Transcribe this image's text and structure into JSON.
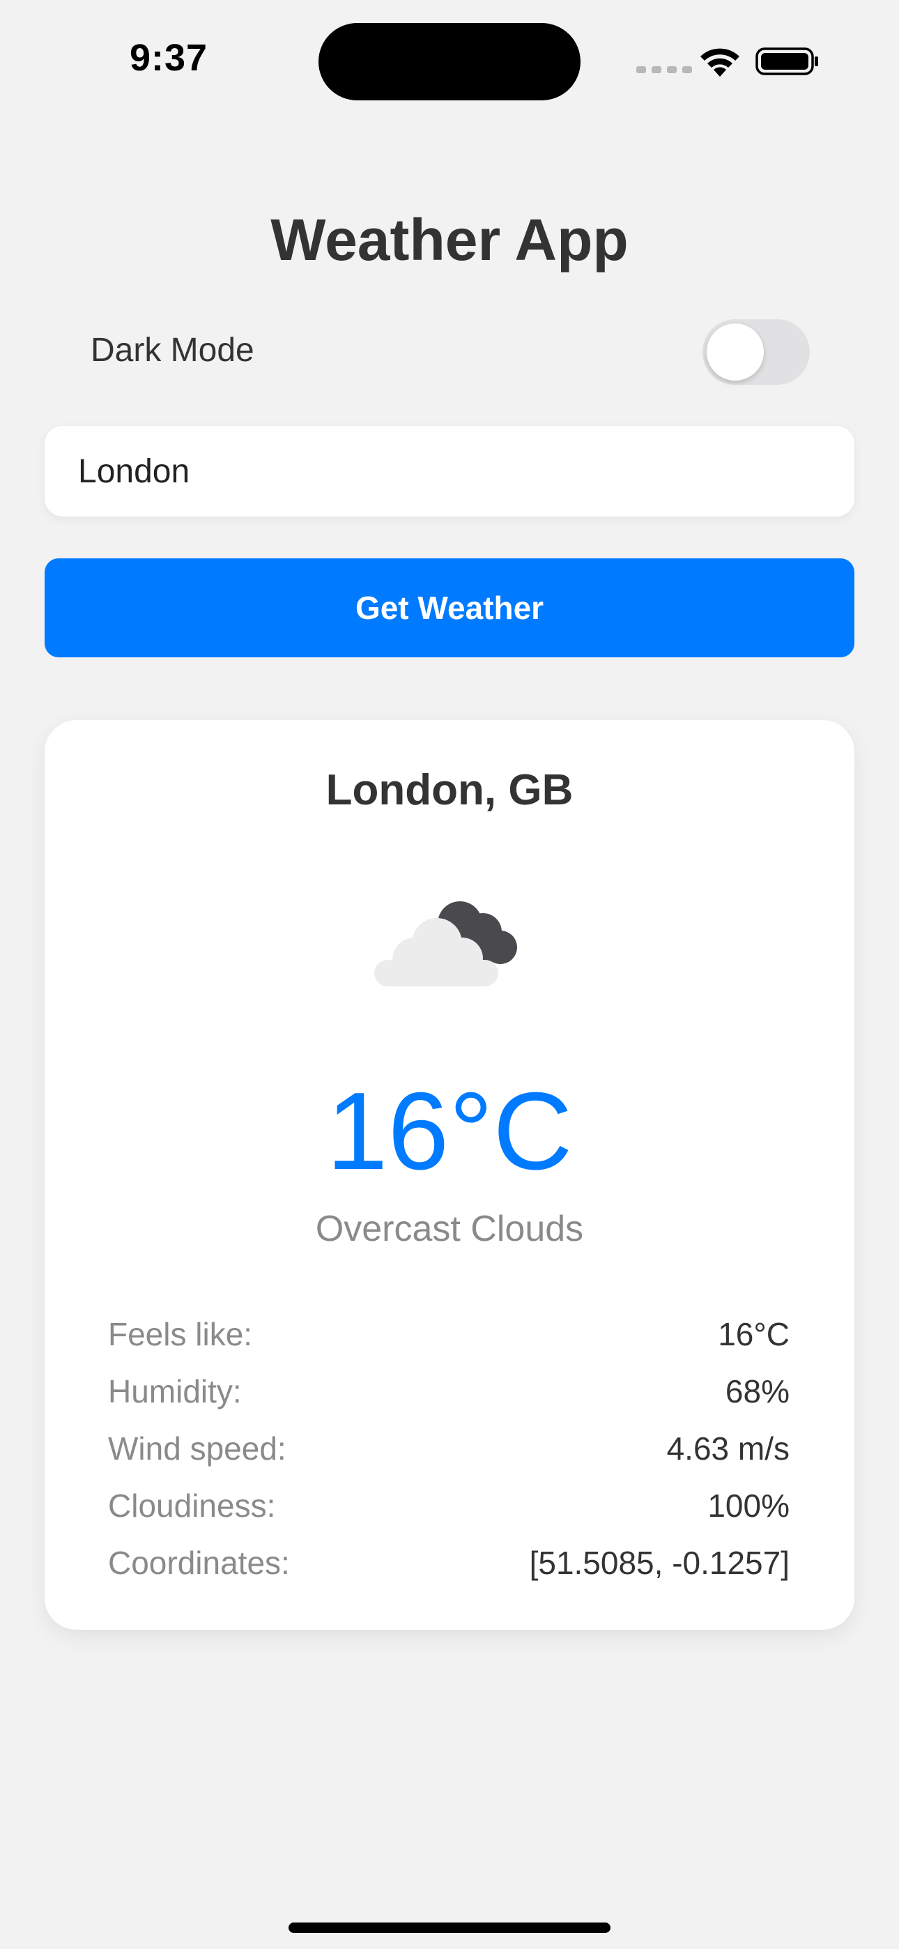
{
  "status_bar": {
    "time": "9:37",
    "icons": [
      "cellular-signal-icon",
      "wifi-icon",
      "battery-icon"
    ]
  },
  "header": {
    "title": "Weather App"
  },
  "settings": {
    "dark_mode_label": "Dark Mode",
    "dark_mode_on": false
  },
  "search": {
    "value": "London",
    "button_label": "Get Weather"
  },
  "weather": {
    "location": "London, GB",
    "icon": "overcast-clouds-icon",
    "temperature": "16°C",
    "condition": "Overcast Clouds",
    "details": [
      {
        "label": "Feels like:",
        "value": "16°C"
      },
      {
        "label": "Humidity:",
        "value": "68%"
      },
      {
        "label": "Wind speed:",
        "value": "4.63 m/s"
      },
      {
        "label": "Cloudiness:",
        "value": "100%"
      },
      {
        "label": "Coordinates:",
        "value": "[51.5085, -0.1257]"
      }
    ]
  },
  "colors": {
    "accent": "#007aff",
    "background": "#f2f2f2",
    "card": "#ffffff",
    "text_primary": "#333333",
    "text_secondary": "#8a8a8a"
  }
}
